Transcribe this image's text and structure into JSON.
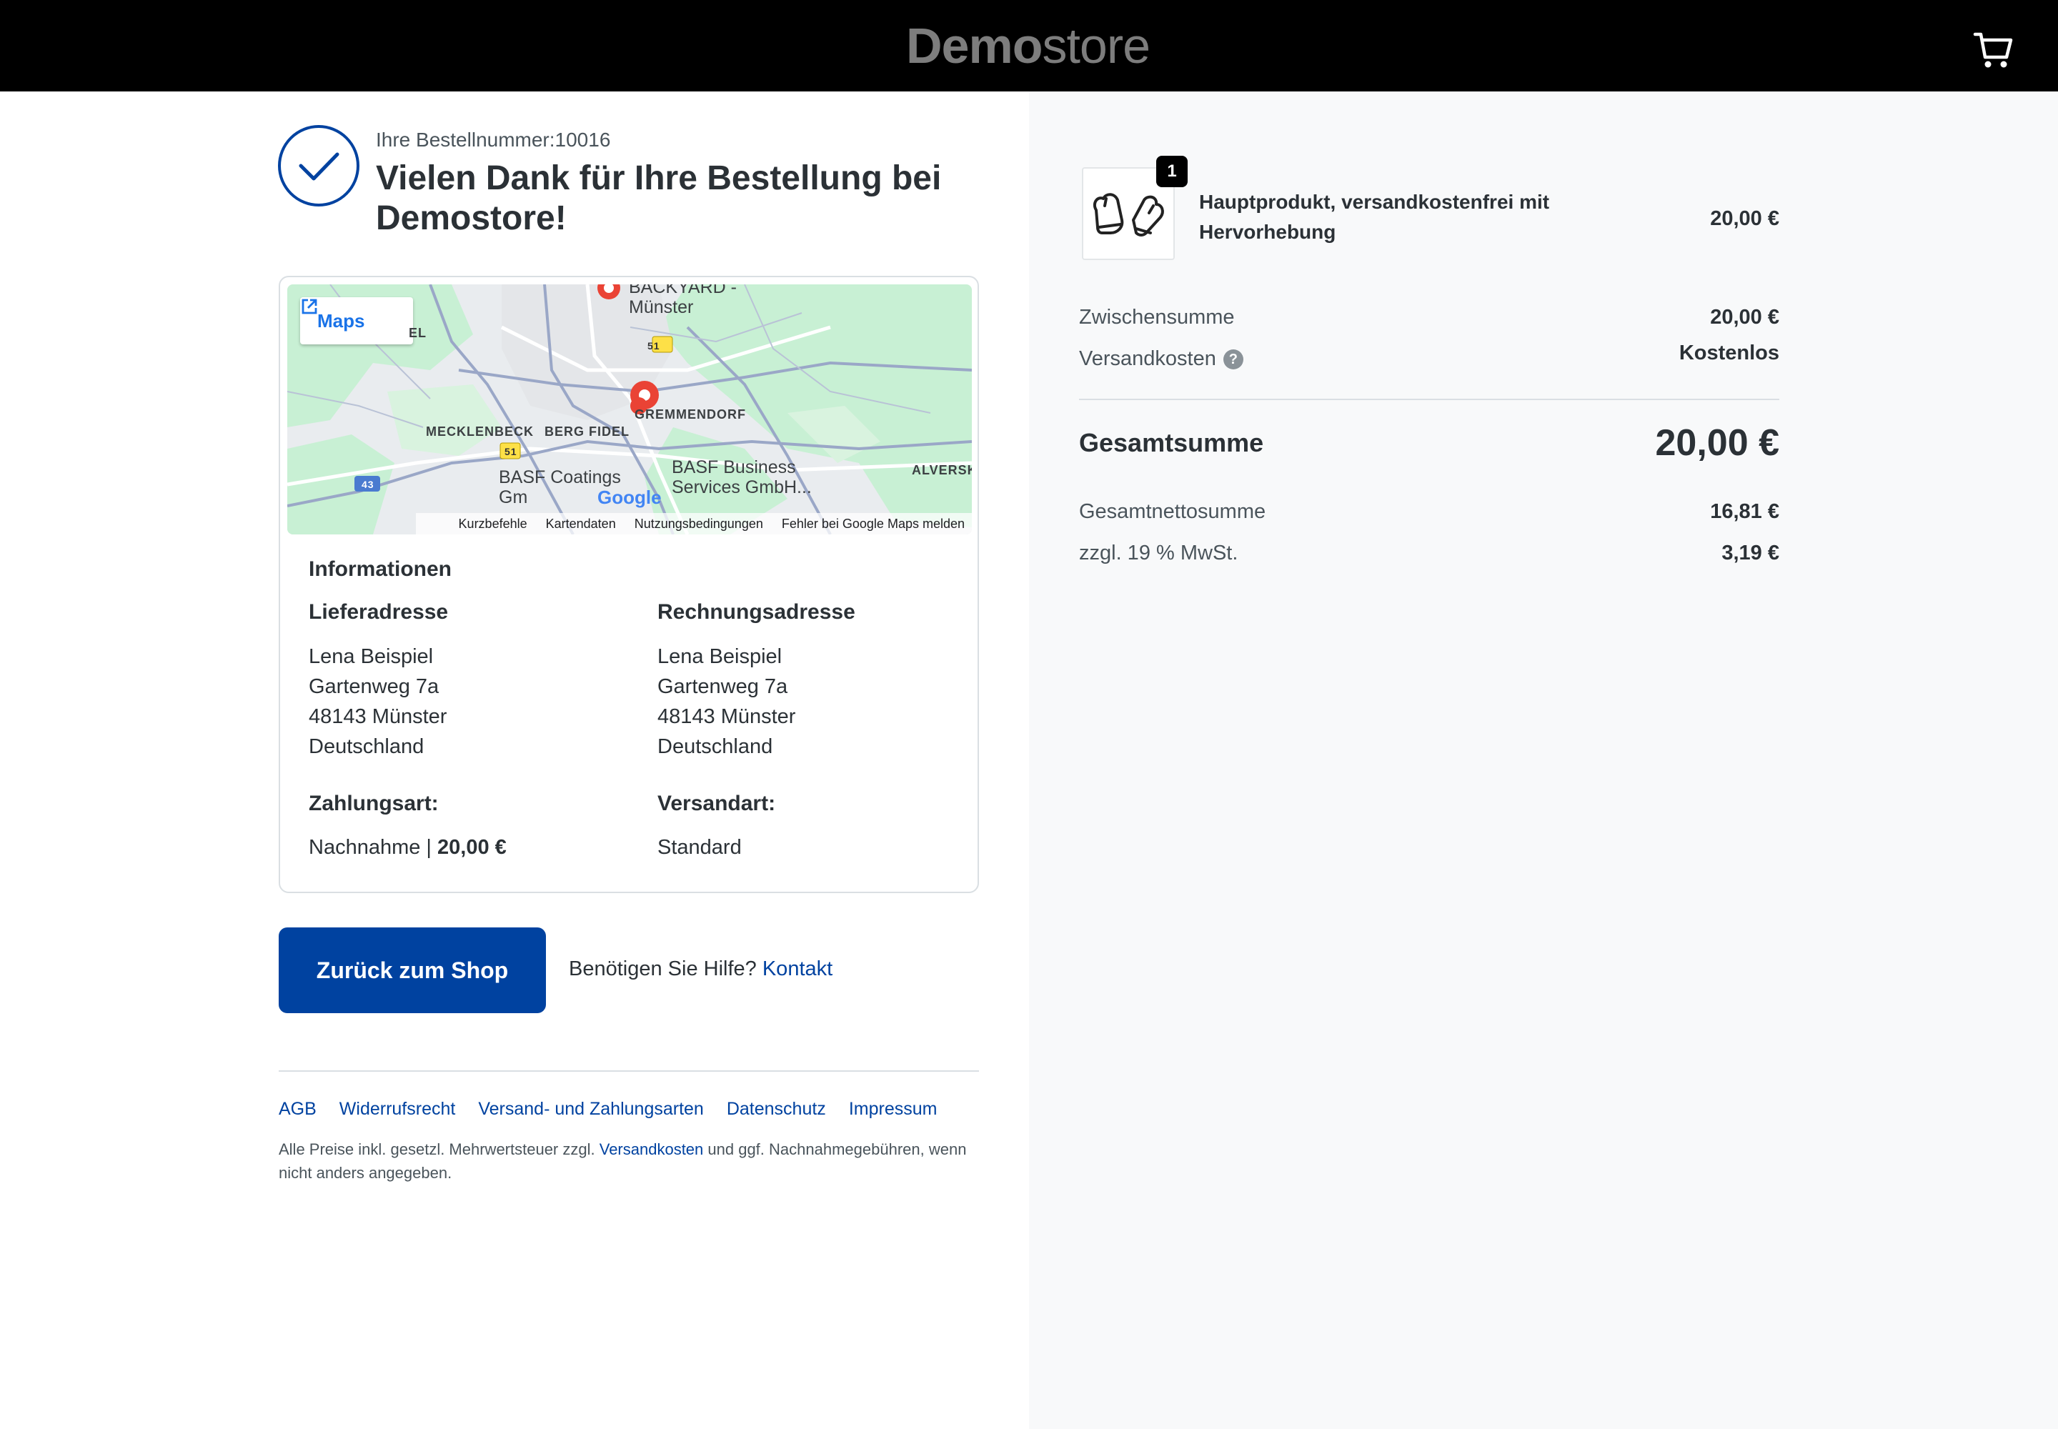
{
  "header": {
    "logo_strong": "Demo",
    "logo_light": "store"
  },
  "confirmation": {
    "order_number": "Ihre Bestellnummer:10016",
    "title": "Vielen Dank für Ihre Bestellung bei Demostore!"
  },
  "map": {
    "maps_button": "Maps",
    "labels": {
      "backyard": "BACKYARD - Münster",
      "mecklenbeck": "MECKLENBECK",
      "berg_fidel": "BERG FIDEL",
      "gremmendorf": "GREMMENDORF",
      "alverskirchen": "ALVERSK",
      "basf_coatings": "BASF Coatings Gm",
      "basf_business_1": "BASF Business",
      "basf_business_2": "Services GmbH...",
      "el": "EL",
      "road_51a": "51",
      "road_51b": "51",
      "road_43": "43",
      "google": "Google"
    },
    "footer": [
      "Kurzbefehle",
      "Kartendaten",
      "Nutzungsbedingungen",
      "Fehler bei Google Maps melden"
    ]
  },
  "info": {
    "title": "Informationen",
    "delivery": {
      "title": "Lieferadresse",
      "lines": [
        "Lena Beispiel",
        "Gartenweg 7a",
        "48143 Münster",
        "Deutschland"
      ]
    },
    "billing": {
      "title": "Rechnungsadresse",
      "lines": [
        "Lena Beispiel",
        "Gartenweg 7a",
        "48143 Münster",
        "Deutschland"
      ]
    },
    "payment": {
      "title": "Zahlungsart:",
      "method": "Nachnahme | ",
      "amount": "20,00 €"
    },
    "shipping": {
      "title": "Versandart:",
      "method": "Standard"
    }
  },
  "actions": {
    "back_button": "Zurück zum Shop",
    "help_text": "Benötigen Sie Hilfe? ",
    "help_link": "Kontakt"
  },
  "footer": {
    "links": [
      "AGB",
      "Widerrufsrecht",
      "Versand- und Zahlungsarten",
      "Datenschutz",
      "Impressum"
    ],
    "note_before": "Alle Preise inkl. gesetzl. Mehrwertsteuer zzgl. ",
    "note_link": "Versandkosten",
    "note_after": " und ggf. Nachnahmegebühren, wenn nicht anders angegeben."
  },
  "summary": {
    "product": {
      "quantity": "1",
      "name": "Hauptprodukt, versandkostenfrei mit Hervorhebung",
      "price": "20,00 €"
    },
    "subtotal_label": "Zwischensumme",
    "subtotal_value": "20,00 €",
    "shipping_label": "Versandkosten",
    "shipping_value": "Kostenlos",
    "total_label": "Gesamtsumme",
    "total_value": "20,00 €",
    "net_label": "Gesamtnettosumme",
    "net_value": "16,81 €",
    "vat_label": "zzgl. 19 % MwSt.",
    "vat_value": "3,19 €"
  },
  "colors": {
    "primary": "#0042a0",
    "header_bg": "#000000",
    "panel_bg": "#f8f9fa"
  }
}
